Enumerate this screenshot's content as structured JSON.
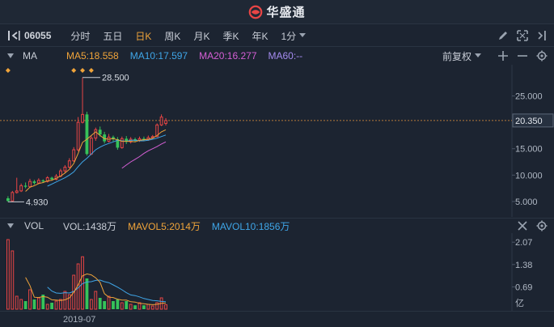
{
  "app": {
    "logo_text": "华盛通"
  },
  "toolbar": {
    "code": "06055",
    "periods": [
      "分时",
      "五日",
      "日K",
      "周K",
      "月K",
      "季K",
      "年K"
    ],
    "active_period": "日K",
    "minute_dropdown": "1分"
  },
  "main_header": {
    "indicator": "MA",
    "ma5": "MA5:18.558",
    "ma10": "MA10:17.597",
    "ma20": "MA20:16.277",
    "ma60": "MA60:--",
    "adjust": "前复权"
  },
  "vol_header": {
    "indicator": "VOL",
    "vol": "VOL:1438万",
    "mavol5": "MAVOL5:2014万",
    "mavol10": "MAVOL10:1856万"
  },
  "x_axis": {
    "label": "2019-07"
  },
  "colors": {
    "up": "#e84545",
    "down": "#36c35a",
    "ma5": "#f0a43a",
    "ma10": "#3fa6e8",
    "ma20": "#d55fd5",
    "background": "#1c2431"
  },
  "chart_data": [
    {
      "type": "candlestick",
      "y_axis_labels": [
        "25.000",
        "20.000",
        "15.000",
        "10.000",
        "5.000"
      ],
      "y_ticks": [
        25,
        20,
        15,
        10,
        5
      ],
      "ylim": [
        3.3,
        30.3
      ],
      "high_annotation": "28.500",
      "low_annotation": "4.930",
      "current_price": "20.350",
      "current_price_value": 20.35,
      "candles": [
        {
          "o": 5.6,
          "c": 5.1,
          "h": 6.0,
          "l": 4.93
        },
        {
          "o": 5.1,
          "c": 6.7,
          "h": 7.0,
          "l": 5.0
        },
        {
          "o": 6.7,
          "c": 7.0,
          "h": 9.5,
          "l": 6.5
        },
        {
          "o": 7.0,
          "c": 8.0,
          "h": 8.4,
          "l": 6.8
        },
        {
          "o": 8.0,
          "c": 7.8,
          "h": 8.6,
          "l": 7.5
        },
        {
          "o": 7.8,
          "c": 8.8,
          "h": 9.3,
          "l": 7.6
        },
        {
          "o": 8.8,
          "c": 8.5,
          "h": 9.1,
          "l": 8.2
        },
        {
          "o": 8.5,
          "c": 9.0,
          "h": 9.4,
          "l": 8.3
        },
        {
          "o": 9.0,
          "c": 8.8,
          "h": 9.2,
          "l": 8.5
        },
        {
          "o": 8.8,
          "c": 9.5,
          "h": 9.8,
          "l": 8.6
        },
        {
          "o": 9.5,
          "c": 9.2,
          "h": 9.7,
          "l": 9.0
        },
        {
          "o": 9.2,
          "c": 9.8,
          "h": 10.2,
          "l": 9.0
        },
        {
          "o": 9.8,
          "c": 10.8,
          "h": 11.2,
          "l": 9.6
        },
        {
          "o": 10.8,
          "c": 11.5,
          "h": 11.9,
          "l": 10.4
        },
        {
          "o": 11.5,
          "c": 12.7,
          "h": 13.2,
          "l": 11.3
        },
        {
          "o": 12.7,
          "c": 14.8,
          "h": 15.3,
          "l": 12.5
        },
        {
          "o": 14.8,
          "c": 20.0,
          "h": 21.0,
          "l": 14.5
        },
        {
          "o": 20.0,
          "c": 21.5,
          "h": 28.5,
          "l": 19.8
        },
        {
          "o": 21.5,
          "c": 14.0,
          "h": 22.0,
          "l": 13.7
        },
        {
          "o": 14.0,
          "c": 17.0,
          "h": 17.5,
          "l": 13.8
        },
        {
          "o": 17.0,
          "c": 18.6,
          "h": 19.0,
          "l": 16.5
        },
        {
          "o": 18.6,
          "c": 17.7,
          "h": 19.2,
          "l": 17.3
        },
        {
          "o": 17.7,
          "c": 16.4,
          "h": 18.2,
          "l": 16.0
        },
        {
          "o": 16.4,
          "c": 17.2,
          "h": 17.8,
          "l": 16.2
        },
        {
          "o": 17.2,
          "c": 16.8,
          "h": 17.5,
          "l": 16.4
        },
        {
          "o": 16.8,
          "c": 15.2,
          "h": 17.2,
          "l": 14.8
        },
        {
          "o": 15.2,
          "c": 16.9,
          "h": 17.3,
          "l": 15.0
        },
        {
          "o": 16.9,
          "c": 16.3,
          "h": 17.4,
          "l": 15.9
        },
        {
          "o": 16.3,
          "c": 16.8,
          "h": 17.2,
          "l": 16.0
        },
        {
          "o": 16.8,
          "c": 16.5,
          "h": 17.1,
          "l": 16.3
        },
        {
          "o": 16.5,
          "c": 16.9,
          "h": 17.3,
          "l": 16.3
        },
        {
          "o": 16.9,
          "c": 16.7,
          "h": 17.3,
          "l": 16.5
        },
        {
          "o": 16.7,
          "c": 17.1,
          "h": 17.5,
          "l": 16.5
        },
        {
          "o": 17.1,
          "c": 17.3,
          "h": 17.6,
          "l": 16.9
        },
        {
          "o": 17.3,
          "c": 19.5,
          "h": 19.8,
          "l": 17.2
        },
        {
          "o": 19.5,
          "c": 21.0,
          "h": 21.5,
          "l": 19.3
        },
        {
          "o": 19.8,
          "c": 20.35,
          "h": 20.8,
          "l": 19.4
        }
      ],
      "ma5_line": [
        null,
        null,
        null,
        null,
        6.9,
        7.7,
        8.0,
        8.4,
        8.6,
        8.9,
        9.0,
        9.4,
        9.8,
        10.4,
        11.1,
        12.2,
        14.1,
        16.2,
        16.8,
        17.5,
        18.2,
        17.5,
        16.9,
        16.8,
        16.9,
        16.7,
        16.4,
        16.4,
        16.4,
        16.3,
        16.6,
        16.7,
        16.8,
        17.0,
        17.5,
        18.2,
        18.6
      ],
      "ma10_line": [
        null,
        null,
        null,
        null,
        null,
        null,
        null,
        null,
        null,
        7.9,
        8.3,
        8.7,
        9.1,
        9.5,
        10.0,
        10.6,
        11.6,
        12.5,
        13.2,
        14.0,
        14.8,
        15.3,
        15.7,
        16.0,
        16.3,
        16.6,
        16.5,
        16.4,
        16.6,
        16.6,
        16.5,
        16.5,
        16.6,
        16.8,
        17.0,
        17.3,
        17.6
      ],
      "ma20_line": [
        null,
        null,
        null,
        null,
        null,
        null,
        null,
        null,
        null,
        null,
        null,
        null,
        null,
        null,
        null,
        null,
        null,
        null,
        null,
        null,
        null,
        null,
        null,
        null,
        null,
        null,
        11.3,
        11.9,
        12.5,
        13.0,
        13.5,
        14.1,
        14.6,
        15.0,
        15.4,
        15.9,
        16.3
      ]
    },
    {
      "type": "bar",
      "title": "VOL",
      "y_axis_labels": [
        "2.07",
        "1.38",
        "0.69",
        "亿"
      ],
      "y_ticks": [
        2.07,
        1.38,
        0.69
      ],
      "ylim": [
        0,
        2.25
      ],
      "values": [
        2.15,
        1.8,
        0.4,
        0.3,
        0.25,
        0.6,
        0.3,
        0.35,
        0.45,
        0.15,
        0.2,
        0.25,
        0.3,
        0.55,
        0.45,
        1.05,
        1.4,
        1.62,
        0.95,
        0.3,
        0.55,
        0.35,
        0.25,
        0.4,
        0.25,
        0.3,
        0.2,
        0.25,
        0.15,
        0.12,
        0.2,
        0.12,
        0.15,
        0.1,
        0.2,
        0.35,
        0.14
      ],
      "mavol5_line": [
        null,
        null,
        null,
        null,
        0.98,
        0.73,
        0.37,
        0.36,
        0.39,
        0.37,
        0.29,
        0.28,
        0.27,
        0.29,
        0.35,
        0.52,
        0.75,
        1.03,
        1.09,
        1.06,
        0.97,
        0.83,
        0.48,
        0.37,
        0.36,
        0.31,
        0.28,
        0.28,
        0.23,
        0.22,
        0.18,
        0.17,
        0.15,
        0.14,
        0.15,
        0.18,
        0.19
      ],
      "mavol10_line": [
        null,
        null,
        null,
        null,
        null,
        null,
        null,
        null,
        null,
        0.68,
        0.56,
        0.5,
        0.49,
        0.51,
        0.5,
        0.55,
        0.66,
        0.79,
        0.84,
        0.85,
        0.89,
        0.9,
        0.85,
        0.82,
        0.75,
        0.68,
        0.6,
        0.51,
        0.44,
        0.42,
        0.38,
        0.33,
        0.3,
        0.27,
        0.26,
        0.24,
        0.23
      ],
      "up_flags": [
        1,
        1,
        1,
        1,
        0,
        1,
        0,
        1,
        0,
        1,
        0,
        1,
        1,
        1,
        1,
        1,
        1,
        1,
        0,
        1,
        1,
        0,
        0,
        1,
        0,
        0,
        1,
        0,
        1,
        0,
        1,
        0,
        1,
        1,
        1,
        1,
        1
      ]
    }
  ]
}
